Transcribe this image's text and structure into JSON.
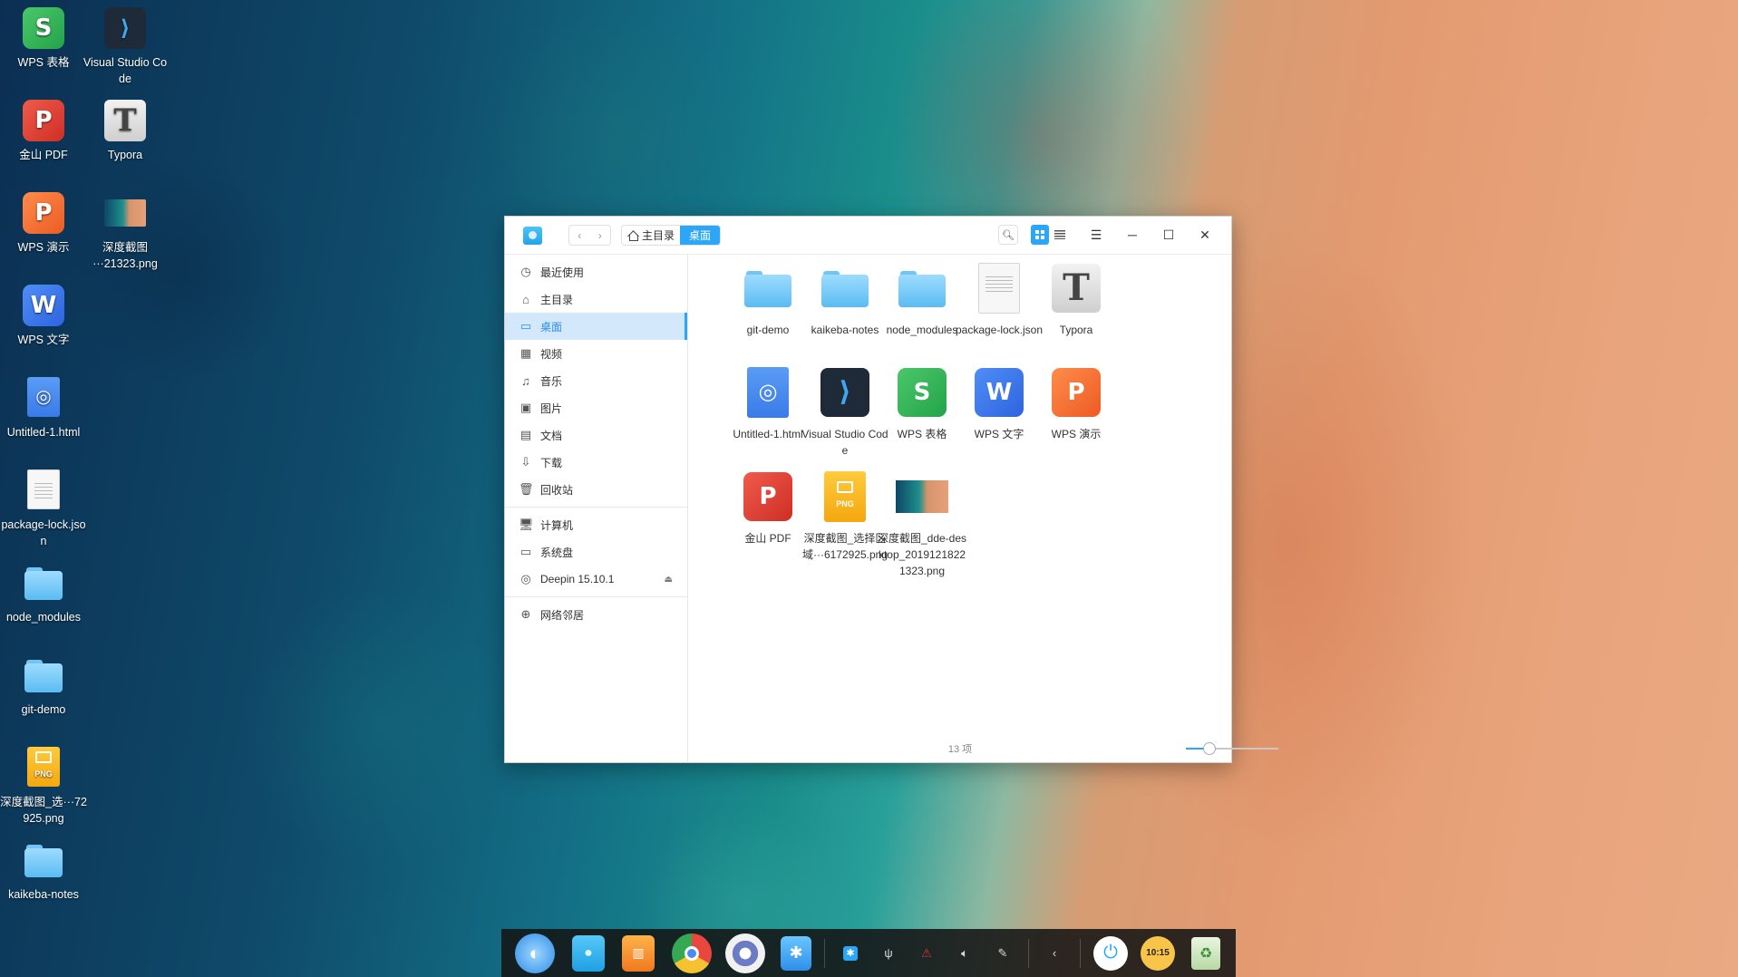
{
  "desktop": {
    "icons": [
      {
        "label": "WPS 表格",
        "icon": "wps-sheets-icon"
      },
      {
        "label": "Visual Studio Code",
        "icon": "vscode-icon"
      },
      {
        "label": "金山 PDF",
        "icon": "kingsoft-pdf-icon"
      },
      {
        "label": "Typora",
        "icon": "typora-icon"
      },
      {
        "label": "WPS 演示",
        "icon": "wps-presentation-icon"
      },
      {
        "label": "深度截图\n···21323.png",
        "icon": "screenshot-thumbnail"
      },
      {
        "label": "WPS 文字",
        "icon": "wps-writer-icon"
      },
      {
        "label": "Untitled-1.html",
        "icon": "html-file-icon"
      },
      {
        "label": "package-lock.json",
        "icon": "json-file-icon"
      },
      {
        "label": "node_modules",
        "icon": "folder-icon"
      },
      {
        "label": "git-demo",
        "icon": "folder-icon"
      },
      {
        "label": "深度截图_选···72925.png",
        "icon": "png-file-icon"
      },
      {
        "label": "kaikeba-notes",
        "icon": "folder-icon"
      }
    ]
  },
  "window": {
    "nav": {
      "back": "‹",
      "forward": "›"
    },
    "breadcrumb": {
      "home": "主目录",
      "current": "桌面"
    },
    "sidebar": {
      "items": [
        {
          "label": "最近使用",
          "icon": "clock-icon"
        },
        {
          "label": "主目录",
          "icon": "home-icon"
        },
        {
          "label": "桌面",
          "icon": "desktop-icon"
        },
        {
          "label": "视频",
          "icon": "video-icon"
        },
        {
          "label": "音乐",
          "icon": "music-icon"
        },
        {
          "label": "图片",
          "icon": "picture-icon"
        },
        {
          "label": "文档",
          "icon": "document-icon"
        },
        {
          "label": "下载",
          "icon": "download-icon"
        },
        {
          "label": "回收站",
          "icon": "trash-icon"
        }
      ],
      "devices": [
        {
          "label": "计算机",
          "icon": "computer-icon"
        },
        {
          "label": "系统盘",
          "icon": "disk-icon"
        },
        {
          "label": "Deepin 15.10.1",
          "icon": "disc-icon"
        }
      ],
      "network": {
        "label": "网络邻居",
        "icon": "network-icon"
      }
    },
    "files": [
      {
        "name": "git-demo",
        "icon": "folder-icon"
      },
      {
        "name": "kaikeba-notes",
        "icon": "folder-icon"
      },
      {
        "name": "node_modules",
        "icon": "folder-icon"
      },
      {
        "name": "package-lock.json",
        "icon": "json-file-icon"
      },
      {
        "name": "Typora",
        "icon": "typora-icon"
      },
      {
        "name": "Untitled-1.html",
        "icon": "html-file-icon"
      },
      {
        "name": "Visual Studio Code",
        "icon": "vscode-icon"
      },
      {
        "name": "WPS 表格",
        "icon": "wps-sheets-icon"
      },
      {
        "name": "WPS 文字",
        "icon": "wps-writer-icon"
      },
      {
        "name": "WPS 演示",
        "icon": "wps-presentation-icon"
      },
      {
        "name": "金山 PDF",
        "icon": "kingsoft-pdf-icon"
      },
      {
        "name": "深度截图_选择区域···6172925.png",
        "icon": "png-file-icon"
      },
      {
        "name": "深度截图_dde-desktop_20191218221323.png",
        "icon": "screenshot-thumbnail"
      }
    ],
    "status": {
      "count": "13 项",
      "zoom_level": 0.25
    }
  },
  "dock": {
    "apps": [
      "launcher-icon",
      "file-manager-icon",
      "app-store-icon",
      "chrome-icon",
      "settings-icon",
      "deepin-store-icon"
    ],
    "tray": [
      "bluetooth-icon",
      "usb-icon",
      "network-tray-icon",
      "volume-icon",
      "pen-icon"
    ],
    "clock": "10:15",
    "colors": {
      "accent": "#2ca7f8"
    }
  }
}
